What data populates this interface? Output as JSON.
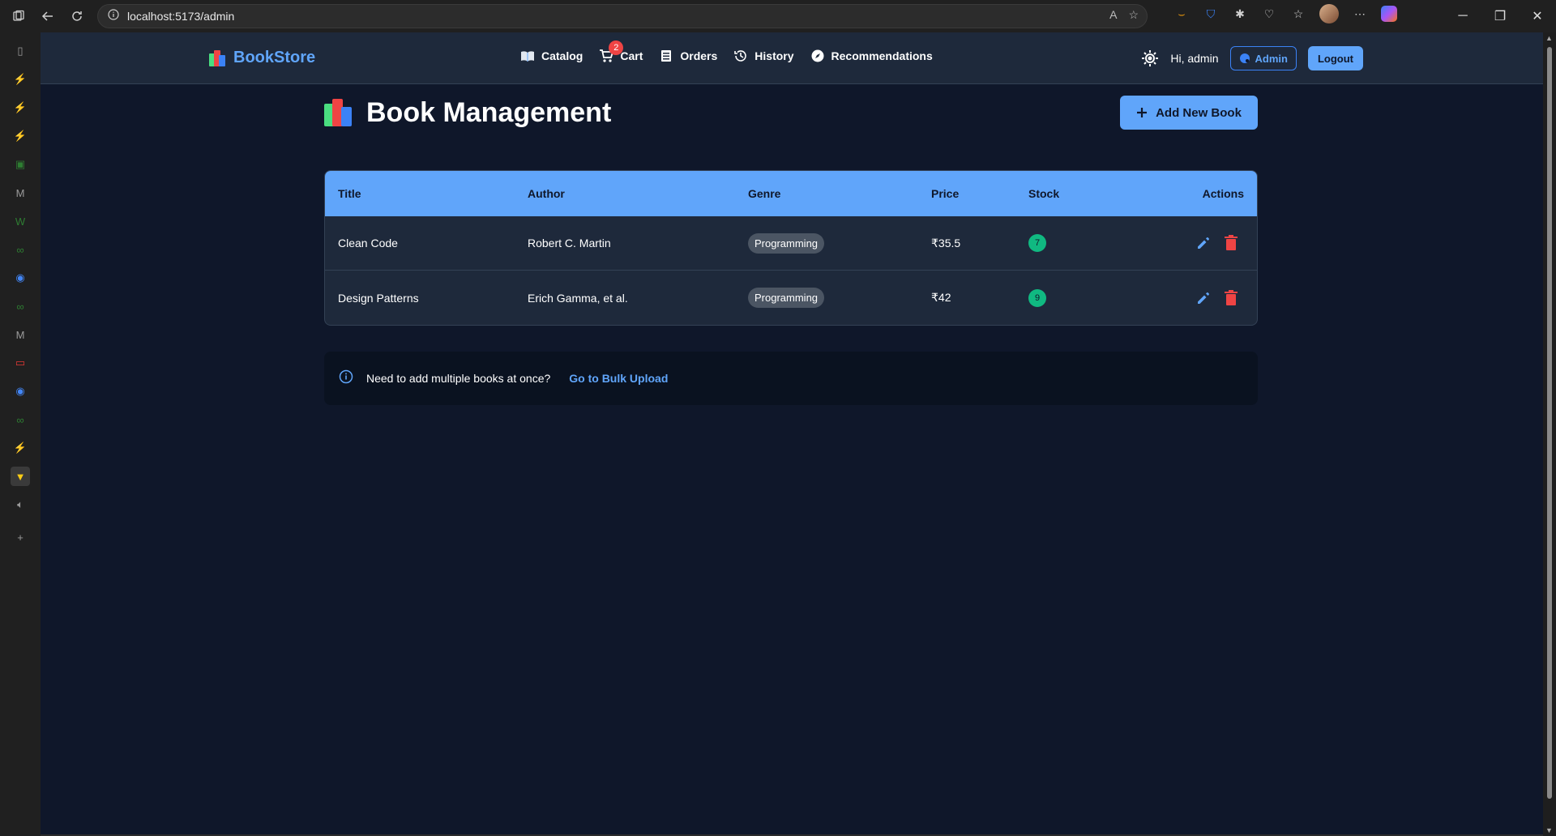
{
  "browser": {
    "url": "localhost:5173/admin"
  },
  "navbar": {
    "brand": "BookStore",
    "links": [
      {
        "label": "Catalog",
        "icon": "book-open-icon"
      },
      {
        "label": "Cart",
        "icon": "cart-icon",
        "badge": "2"
      },
      {
        "label": "Orders",
        "icon": "receipt-icon"
      },
      {
        "label": "History",
        "icon": "history-icon"
      },
      {
        "label": "Recommendations",
        "icon": "compass-icon"
      }
    ],
    "greeting": "Hi, admin",
    "admin_label": "Admin",
    "logout_label": "Logout"
  },
  "page": {
    "title": "Book Management",
    "add_button": "Add New Book"
  },
  "table": {
    "headers": [
      "Title",
      "Author",
      "Genre",
      "Price",
      "Stock",
      "Actions"
    ],
    "rows": [
      {
        "title": "Clean Code",
        "author": "Robert C. Martin",
        "genre": "Programming",
        "price": "₹35.5",
        "stock": "7"
      },
      {
        "title": "Design Patterns",
        "author": "Erich Gamma, et al.",
        "genre": "Programming",
        "price": "₹42",
        "stock": "9"
      }
    ]
  },
  "info": {
    "text": "Need to add multiple books at once?",
    "link": "Go to Bulk Upload"
  },
  "colors": {
    "accent": "#60a5fa",
    "background": "#0f172a",
    "surface": "#1e293b",
    "danger": "#ef4444",
    "success": "#10b981"
  }
}
